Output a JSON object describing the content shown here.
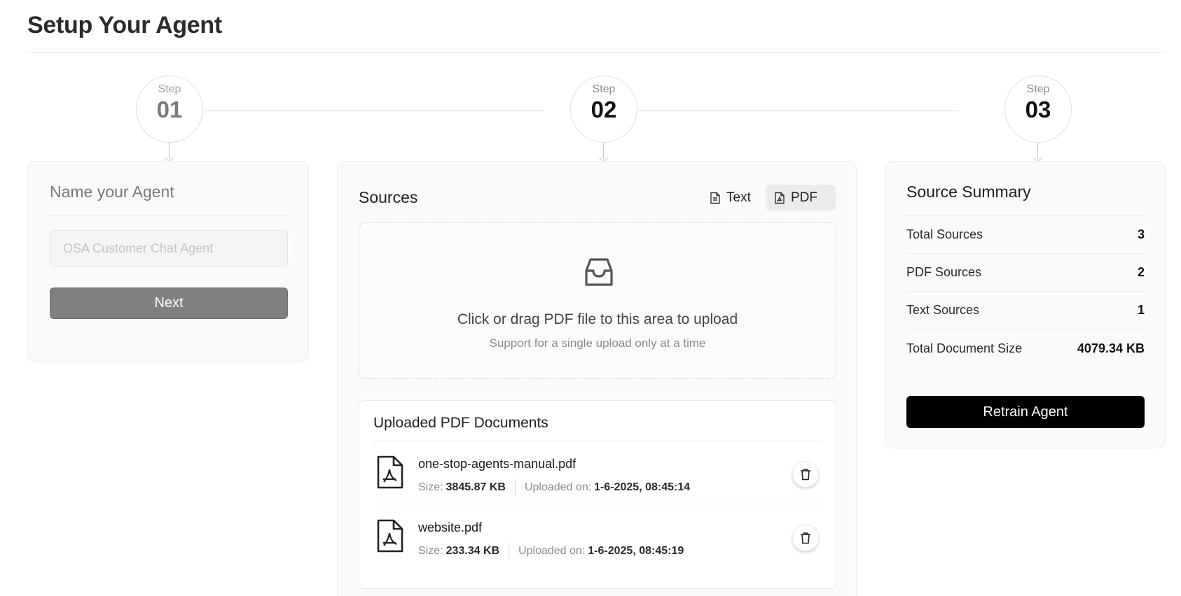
{
  "page": {
    "title": "Setup Your Agent"
  },
  "steps": [
    {
      "label": "Step",
      "number": "01"
    },
    {
      "label": "Step",
      "number": "02"
    },
    {
      "label": "Step",
      "number": "03"
    }
  ],
  "name_card": {
    "title": "Name your Agent",
    "input_value": "",
    "input_placeholder": "OSA Customer Chat Agent",
    "next_label": "Next"
  },
  "sources_card": {
    "title": "Sources",
    "tabs": {
      "text": "Text",
      "pdf": "PDF",
      "active": "PDF"
    },
    "dropzone": {
      "icon": "inbox-icon",
      "main_text": "Click or drag PDF file to this area to upload",
      "hint_text": "Support for a single upload only at a time"
    },
    "uploaded": {
      "title": "Uploaded PDF Documents",
      "size_label": "Size:",
      "uploaded_label": "Uploaded on:",
      "documents": [
        {
          "name": "one-stop-agents-manual.pdf",
          "size": "3845.87 KB",
          "uploaded_on": "1-6-2025, 08:45:14"
        },
        {
          "name": "website.pdf",
          "size": "233.34 KB",
          "uploaded_on": "1-6-2025, 08:45:19"
        }
      ]
    }
  },
  "summary_card": {
    "title": "Source Summary",
    "rows": [
      {
        "label": "Total Sources",
        "value": "3"
      },
      {
        "label": "PDF Sources",
        "value": "2"
      },
      {
        "label": "Text Sources",
        "value": "1"
      },
      {
        "label": "Total Document Size",
        "value": "4079.34 KB"
      }
    ],
    "retrain_label": "Retrain Agent"
  },
  "colors": {
    "primary_button": "#000000",
    "disabled_button": "#808080",
    "card_bg": "#fafafa"
  }
}
